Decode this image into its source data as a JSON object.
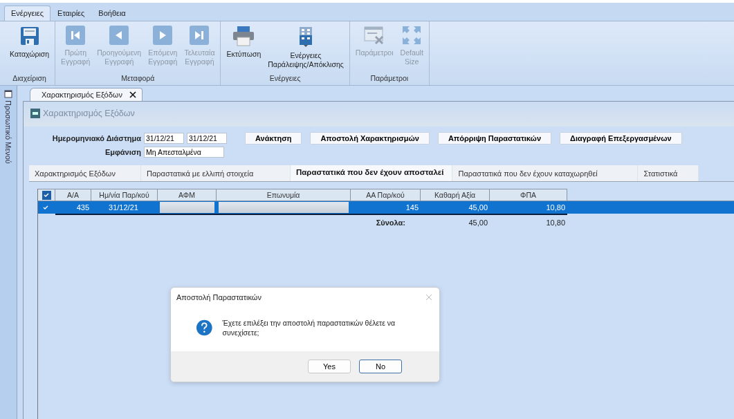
{
  "menu_tabs": [
    {
      "label": "Ενέργειες",
      "selected": true
    },
    {
      "label": "Εταιρίες",
      "selected": false
    },
    {
      "label": "Βοήθεια",
      "selected": false
    }
  ],
  "ribbon_groups": [
    {
      "label": "Διαχείριση",
      "buttons": [
        {
          "label": "Καταχώριση",
          "disabled": false
        }
      ]
    },
    {
      "label": "Μεταφορά",
      "buttons": [
        {
          "label": "Πρώτη\nΕγγραφή",
          "disabled": true
        },
        {
          "label": "Προηγούμενη\nΕγγραφή",
          "disabled": true
        },
        {
          "label": "Επόμενη\nΕγγραφή",
          "disabled": true
        },
        {
          "label": "Τελευταία\nΕγγραφή",
          "disabled": true
        }
      ]
    },
    {
      "label": "Ενέργειες",
      "buttons": [
        {
          "label": "Εκτύπωση",
          "disabled": false
        },
        {
          "label": "Ενέργειες\nΠαράλειψης/Απόκλισης",
          "disabled": false
        }
      ]
    },
    {
      "label": "Παράμετροι",
      "buttons": [
        {
          "label": "Παράμετροι",
          "disabled": true
        },
        {
          "label": "Default\nSize",
          "disabled": true
        }
      ]
    }
  ],
  "side_panel": {
    "label": "Προσωπικό Μενού"
  },
  "document_tab": {
    "label": "Χαρακτηρισμός Εξόδων"
  },
  "form": {
    "title": "Χαρακτηρισμός Εξόδων",
    "date_range_label": "Ημερομηνιακό Διάστημα",
    "date_from": "31/12/21",
    "date_to": "31/12/21",
    "show_label": "Εμφάνιση",
    "show_value": "Μη Απεσταλμένα",
    "actions": [
      "Ανάκτηση",
      "Αποστολή Χαρακτηρισμών",
      "Απόρριψη Παραστατικών",
      "Διαγραφή Επεξεργασμένων"
    ]
  },
  "tabs": [
    {
      "label": "Χαρακτηρισμός Εξόδων",
      "selected": false
    },
    {
      "label": "Παραστατικά με ελλιπή στοιχεία",
      "selected": false
    },
    {
      "label": "Παραστατικά που δεν έχουν αποσταλεί",
      "selected": true
    },
    {
      "label": "Παραστατικά που δεν έχουν καταχωρηθεί",
      "selected": false
    },
    {
      "label": "Στατιστικά",
      "selected": false
    }
  ],
  "table": {
    "header_checked": true,
    "columns": [
      "Α/Α",
      "Ημ/νία Παρ/κού",
      "ΑΦΜ",
      "Επωνυμία",
      "ΑΑ Παρ/κού",
      "Καθαρή Αξία",
      "ΦΠΑ"
    ],
    "rows": [
      {
        "selected": true,
        "checked": true,
        "cells": [
          {
            "kind": "text",
            "text": "435"
          },
          {
            "kind": "text",
            "text": "31/12/21"
          },
          {
            "kind": "redacted"
          },
          {
            "kind": "redacted"
          },
          {
            "kind": "text",
            "text": "145"
          },
          {
            "kind": "text",
            "text": "45,00"
          },
          {
            "kind": "text",
            "text": "10,80"
          }
        ]
      }
    ],
    "totals_label": "Σύνολα:",
    "totals": [
      "45,00",
      "10,80"
    ]
  },
  "dialog": {
    "title": "Αποστολή Παραστατικών",
    "message": "Έχετε επιλέξει την αποστολή παραστατικών θέλετε να συνεχίσετε;",
    "buttons": [
      {
        "label": "Yes",
        "focused": false
      },
      {
        "label": "No",
        "focused": true
      }
    ]
  }
}
